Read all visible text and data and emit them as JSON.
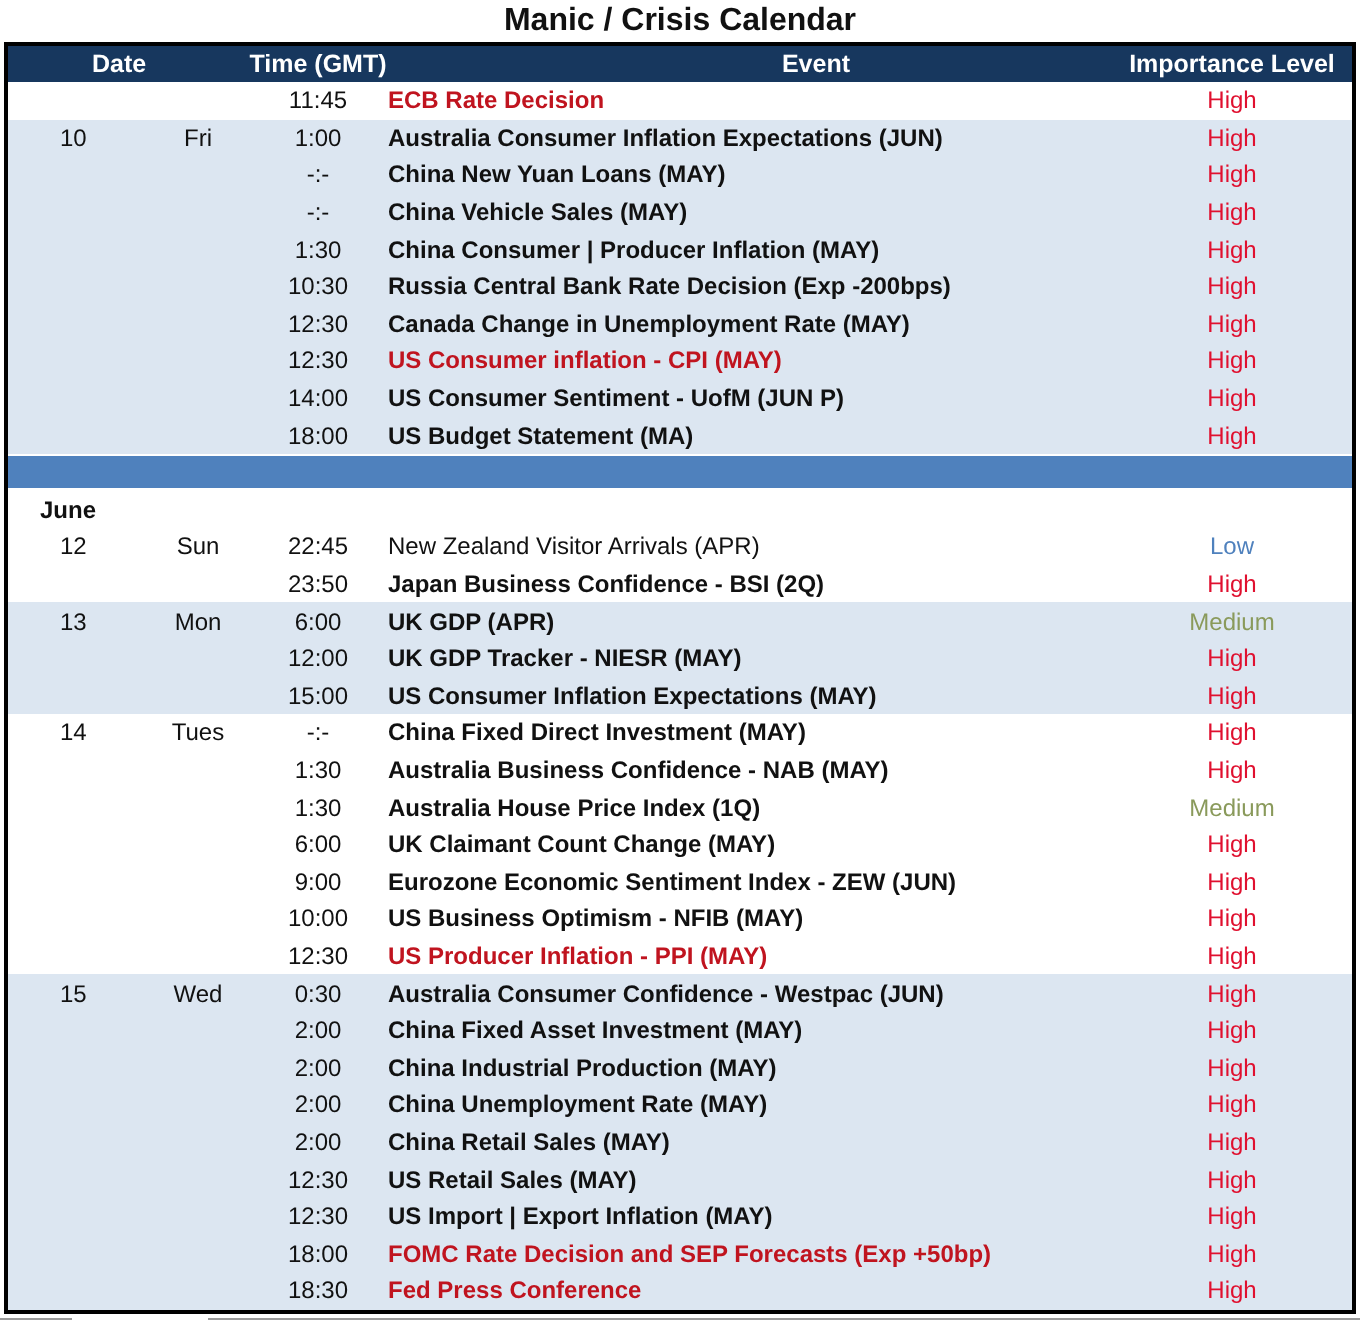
{
  "title": "Manic / Crisis Calendar",
  "columns": [
    "Date",
    "Time (GMT)",
    "Event",
    "Importance Level"
  ],
  "sections": [
    {
      "kind": "group",
      "shaded": false,
      "events": [
        {
          "time": "11:45",
          "event": "ECB Rate Decision",
          "highlighted": true,
          "bold": true,
          "importance": {
            "label": "High",
            "color": "#e0102f"
          }
        }
      ]
    },
    {
      "kind": "group",
      "date": "10",
      "day": "Fri",
      "shaded": true,
      "events": [
        {
          "time": "1:00",
          "event": "Australia Consumer Inflation Expectations (JUN)",
          "highlighted": false,
          "bold": true,
          "importance": {
            "label": "High",
            "color": "#e0102f"
          }
        },
        {
          "time": "-:-",
          "event": "China New Yuan Loans (MAY)",
          "highlighted": false,
          "bold": true,
          "importance": {
            "label": "High",
            "color": "#e0102f"
          }
        },
        {
          "time": "-:-",
          "event": "China Vehicle Sales (MAY)",
          "highlighted": false,
          "bold": true,
          "importance": {
            "label": "High",
            "color": "#e0102f"
          }
        },
        {
          "time": "1:30",
          "event": "China Consumer | Producer Inflation (MAY)",
          "highlighted": false,
          "bold": true,
          "importance": {
            "label": "High",
            "color": "#e0102f"
          }
        },
        {
          "time": "10:30",
          "event": "Russia Central Bank Rate Decision (Exp -200bps)",
          "highlighted": false,
          "bold": true,
          "importance": {
            "label": "High",
            "color": "#e0102f"
          }
        },
        {
          "time": "12:30",
          "event": "Canada Change in Unemployment Rate (MAY)",
          "highlighted": false,
          "bold": true,
          "importance": {
            "label": "High",
            "color": "#e0102f"
          }
        },
        {
          "time": "12:30",
          "event": "US Consumer inflation - CPI (MAY)",
          "highlighted": true,
          "bold": true,
          "importance": {
            "label": "High",
            "color": "#e0102f"
          }
        },
        {
          "time": "14:00",
          "event": "US Consumer Sentiment - UofM (JUN P)",
          "highlighted": false,
          "bold": true,
          "importance": {
            "label": "High",
            "color": "#e0102f"
          }
        },
        {
          "time": "18:00",
          "event": "US Budget Statement (MA)",
          "highlighted": false,
          "bold": true,
          "importance": {
            "label": "High",
            "color": "#e0102f"
          }
        }
      ]
    },
    {
      "kind": "separator"
    },
    {
      "kind": "month",
      "label": "June"
    },
    {
      "kind": "group",
      "date": "12",
      "day": "Sun",
      "shaded": false,
      "events": [
        {
          "time": "22:45",
          "event": "New Zealand Visitor Arrivals (APR)",
          "highlighted": false,
          "bold": false,
          "importance": {
            "label": "Low",
            "color": "#4f81bd"
          }
        },
        {
          "time": "23:50",
          "event": "Japan Business Confidence - BSI (2Q)",
          "highlighted": false,
          "bold": true,
          "importance": {
            "label": "High",
            "color": "#e0102f"
          }
        }
      ]
    },
    {
      "kind": "group",
      "date": "13",
      "day": "Mon",
      "shaded": true,
      "events": [
        {
          "time": "6:00",
          "event": "UK GDP (APR)",
          "highlighted": false,
          "bold": true,
          "importance": {
            "label": "Medium",
            "color": "#8a9a5b"
          }
        },
        {
          "time": "12:00",
          "event": "UK GDP Tracker - NIESR (MAY)",
          "highlighted": false,
          "bold": true,
          "importance": {
            "label": "High",
            "color": "#e0102f"
          }
        },
        {
          "time": "15:00",
          "event": "US Consumer Inflation Expectations (MAY)",
          "highlighted": false,
          "bold": true,
          "importance": {
            "label": "High",
            "color": "#e0102f"
          }
        }
      ]
    },
    {
      "kind": "group",
      "date": "14",
      "day": "Tues",
      "shaded": false,
      "events": [
        {
          "time": "-:-",
          "event": "China Fixed Direct Investment (MAY)",
          "highlighted": false,
          "bold": true,
          "importance": {
            "label": "High",
            "color": "#e0102f"
          }
        },
        {
          "time": "1:30",
          "event": "Australia Business Confidence - NAB (MAY)",
          "highlighted": false,
          "bold": true,
          "importance": {
            "label": "High",
            "color": "#e0102f"
          }
        },
        {
          "time": "1:30",
          "event": "Australia House Price Index (1Q)",
          "highlighted": false,
          "bold": true,
          "importance": {
            "label": "Medium",
            "color": "#8a9a5b"
          }
        },
        {
          "time": "6:00",
          "event": "UK Claimant Count Change (MAY)",
          "highlighted": false,
          "bold": true,
          "importance": {
            "label": "High",
            "color": "#e0102f"
          }
        },
        {
          "time": "9:00",
          "event": "Eurozone Economic Sentiment Index - ZEW (JUN)",
          "highlighted": false,
          "bold": true,
          "importance": {
            "label": "High",
            "color": "#e0102f"
          }
        },
        {
          "time": "10:00",
          "event": "US Business Optimism - NFIB (MAY)",
          "highlighted": false,
          "bold": true,
          "importance": {
            "label": "High",
            "color": "#e0102f"
          }
        },
        {
          "time": "12:30",
          "event": "US Producer Inflation - PPI (MAY)",
          "highlighted": true,
          "bold": true,
          "importance": {
            "label": "High",
            "color": "#e0102f"
          }
        }
      ]
    },
    {
      "kind": "group",
      "date": "15",
      "day": "Wed",
      "shaded": true,
      "events": [
        {
          "time": "0:30",
          "event": "Australia Consumer Confidence - Westpac (JUN)",
          "highlighted": false,
          "bold": true,
          "importance": {
            "label": "High",
            "color": "#e0102f"
          }
        },
        {
          "time": "2:00",
          "event": "China Fixed Asset Investment (MAY)",
          "highlighted": false,
          "bold": true,
          "importance": {
            "label": "High",
            "color": "#e0102f"
          }
        },
        {
          "time": "2:00",
          "event": "China Industrial Production (MAY)",
          "highlighted": false,
          "bold": true,
          "importance": {
            "label": "High",
            "color": "#e0102f"
          }
        },
        {
          "time": "2:00",
          "event": "China Unemployment Rate (MAY)",
          "highlighted": false,
          "bold": true,
          "importance": {
            "label": "High",
            "color": "#e0102f"
          }
        },
        {
          "time": "2:00",
          "event": "China Retail Sales (MAY)",
          "highlighted": false,
          "bold": true,
          "importance": {
            "label": "High",
            "color": "#e0102f"
          }
        },
        {
          "time": "12:30",
          "event": "US Retail Sales (MAY)",
          "highlighted": false,
          "bold": true,
          "importance": {
            "label": "High",
            "color": "#e0102f"
          }
        },
        {
          "time": "12:30",
          "event": "US Import | Export Inflation (MAY)",
          "highlighted": false,
          "bold": true,
          "importance": {
            "label": "High",
            "color": "#e0102f"
          }
        },
        {
          "time": "18:00",
          "event": "FOMC Rate Decision and SEP Forecasts (Exp +50bp)",
          "highlighted": true,
          "bold": true,
          "importance": {
            "label": "High",
            "color": "#e0102f"
          }
        },
        {
          "time": "18:30",
          "event": "Fed Press Conference",
          "highlighted": true,
          "bold": true,
          "importance": {
            "label": "High",
            "color": "#e0102f"
          }
        }
      ]
    }
  ]
}
